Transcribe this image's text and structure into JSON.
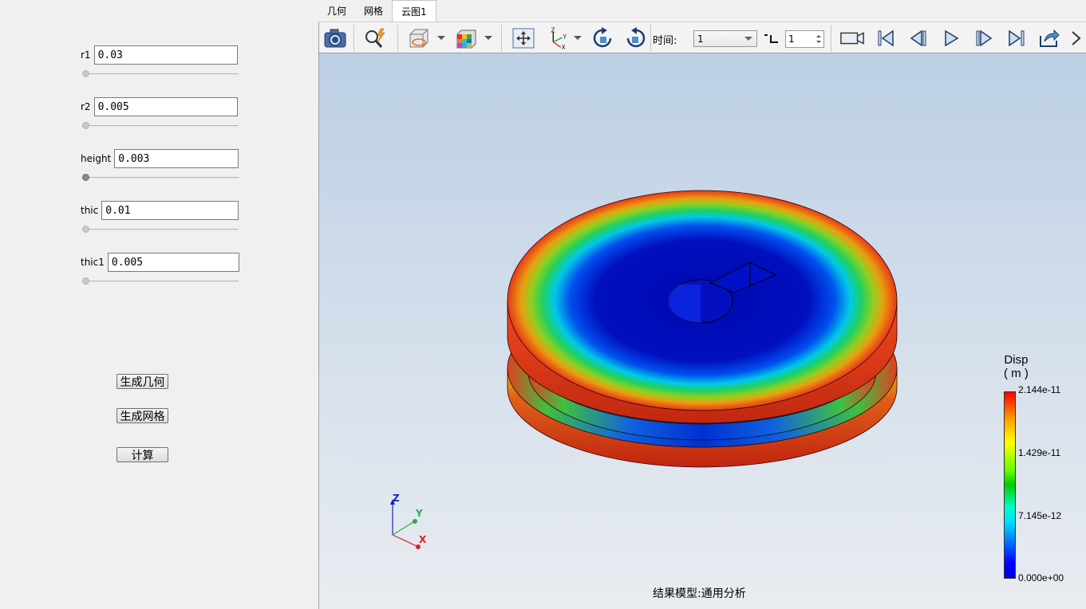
{
  "params": [
    {
      "label": "r1",
      "value": "0.03"
    },
    {
      "label": "r2",
      "value": "0.005"
    },
    {
      "label": "height",
      "value": "0.003"
    },
    {
      "label": "thic",
      "value": "0.01"
    },
    {
      "label": "thic1",
      "value": "0.005"
    }
  ],
  "buttons": {
    "gen_geometry": "生成几何",
    "gen_mesh": "生成网格",
    "compute": "计算"
  },
  "tabs": [
    "几何",
    "网格",
    "云图1"
  ],
  "active_tab": "云图1",
  "toolbar": {
    "time_label": "时间:",
    "time_value": "1",
    "step_value": "1"
  },
  "legend": {
    "title": "Disp",
    "unit": "( m )",
    "ticks": [
      "2.144e-11",
      "1.429e-11",
      "7.145e-12",
      "0.000e+00"
    ]
  },
  "axes": {
    "z": "Z",
    "y": "Y",
    "x": "X"
  },
  "result_model": "结果模型:通用分析",
  "colors": {
    "accent_red": "#e8421f",
    "accent_blue": "#0a1ad6",
    "background_top": "#bccfe5"
  }
}
